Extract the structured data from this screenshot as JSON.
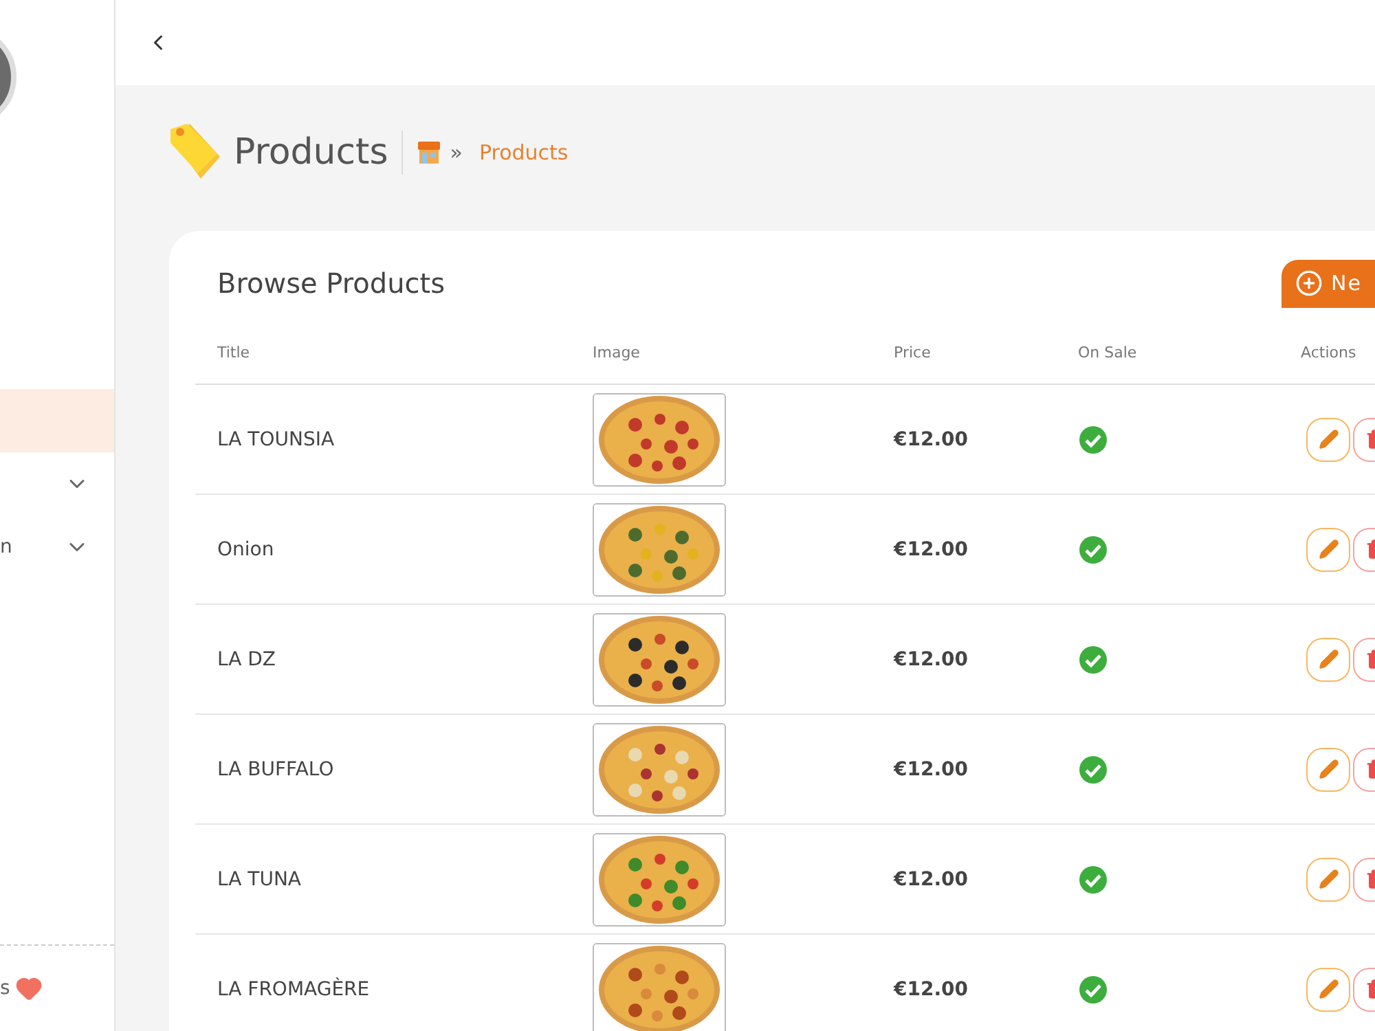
{
  "sidebar": {
    "items": [
      {
        "selected": true,
        "expandable": false
      },
      {
        "selected": false,
        "expandable": true
      },
      {
        "selected": false,
        "expandable": true,
        "label": "n"
      }
    ],
    "footer": "s"
  },
  "page": {
    "title": "Products",
    "breadcrumb": [
      "»",
      "Products"
    ]
  },
  "card": {
    "title": "Browse Products",
    "new_button": "Ne"
  },
  "table": {
    "columns": [
      "Title",
      "Image",
      "Price",
      "On Sale",
      "Actions"
    ],
    "rows": [
      {
        "title": "LA TOUNSIA",
        "price": "€12.00",
        "on_sale": true
      },
      {
        "title": "Onion",
        "price": "€12.00",
        "on_sale": true
      },
      {
        "title": "LA DZ",
        "price": "€12.00",
        "on_sale": true
      },
      {
        "title": "LA BUFFALO",
        "price": "€12.00",
        "on_sale": true
      },
      {
        "title": "LA TUNA",
        "price": "€12.00",
        "on_sale": true
      },
      {
        "title": "LA FROMAGÈRE",
        "price": "€12.00",
        "on_sale": true
      }
    ]
  }
}
